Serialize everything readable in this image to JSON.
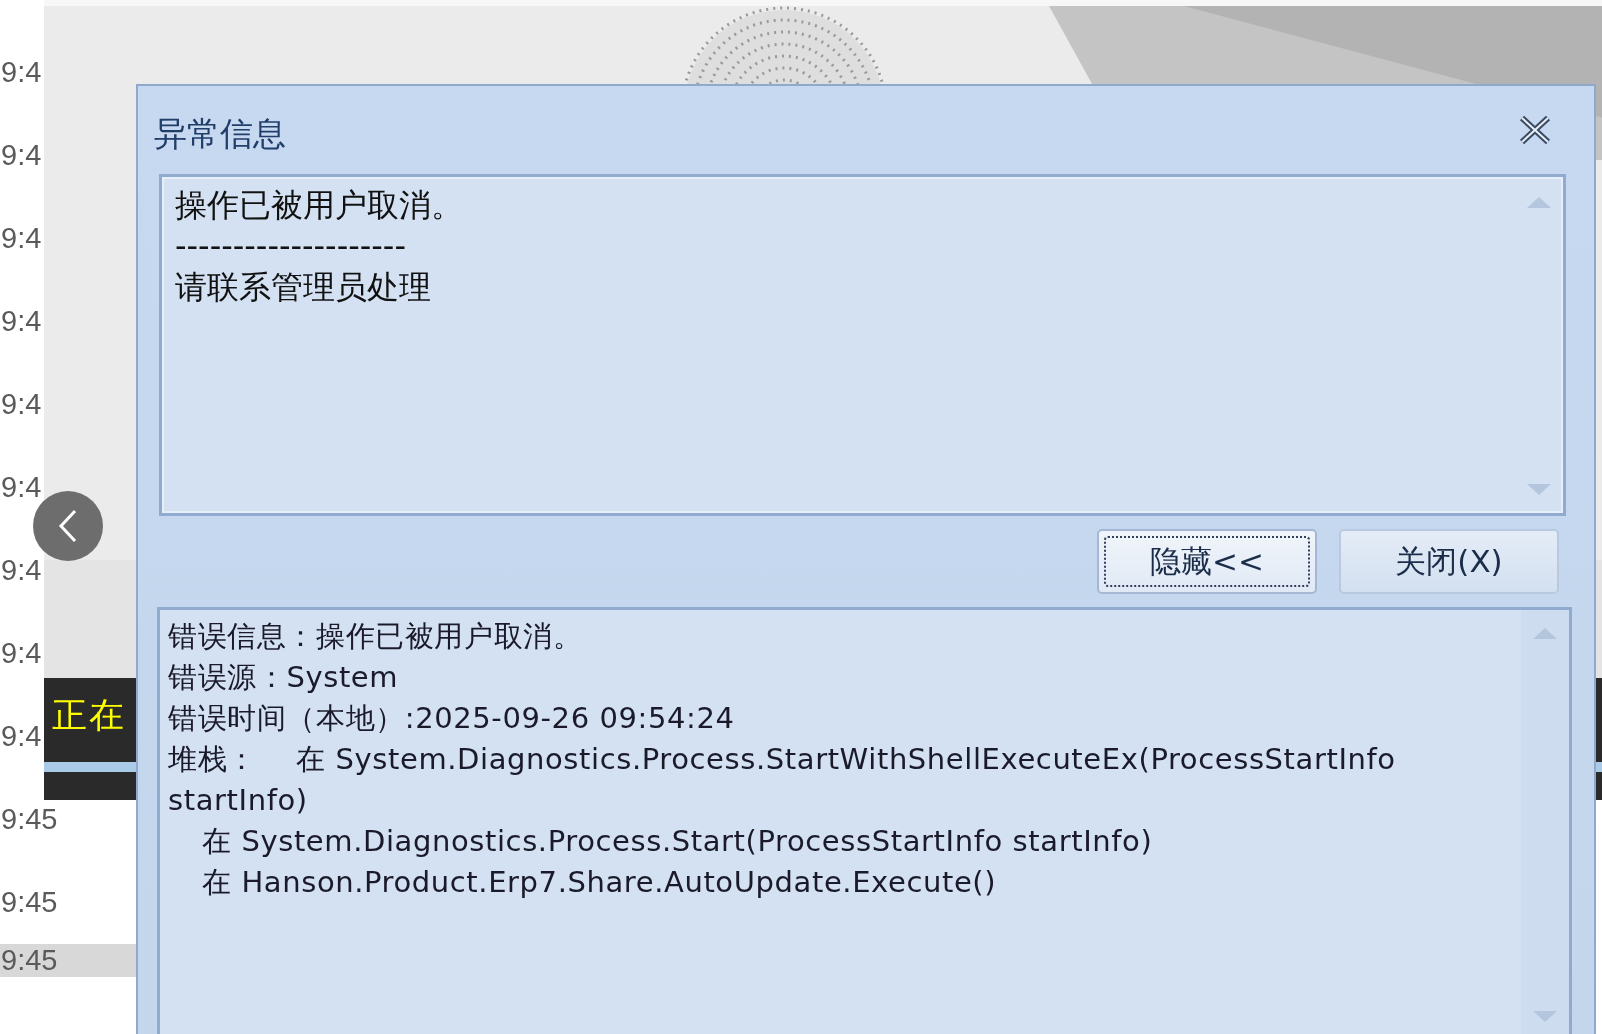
{
  "background_app": {
    "time_rows": [
      {
        "time": "9:4",
        "selected": false
      },
      {
        "time": "9:4",
        "selected": false
      },
      {
        "time": "9:4",
        "selected": false
      },
      {
        "time": "9:4",
        "selected": false
      },
      {
        "time": "9:4",
        "selected": false
      },
      {
        "time": "9:4",
        "selected": false
      },
      {
        "time": "9:4",
        "selected": false
      },
      {
        "time": "9:4",
        "selected": false
      },
      {
        "time": "9:4",
        "selected": false
      },
      {
        "time": "9:45",
        "selected": false
      },
      {
        "time": "9:45",
        "selected": false
      },
      {
        "time": "9:45",
        "selected": true
      }
    ],
    "banner": {
      "text": "正在"
    }
  },
  "dialog": {
    "title": "异常信息",
    "message_lines": [
      "操作已被用户取消。",
      "--------------------",
      "请联系管理员处理"
    ],
    "buttons": [
      {
        "label": "隐藏<<",
        "focused": true
      },
      {
        "label": "关闭(X)",
        "focused": false
      }
    ],
    "detail_lines": [
      {
        "kind": "field",
        "text": "错误信息：操作已被用户取消。"
      },
      {
        "kind": "field",
        "text": "错误源：System"
      },
      {
        "kind": "field",
        "text": "错误时间（本地）:2025-09-26 09:54:24"
      },
      {
        "kind": "field",
        "text": "堆栈：    在 System.Diagnostics.Process.StartWithShellExecuteEx(ProcessStartInfo startInfo)"
      },
      {
        "kind": "frame",
        "text": "在 System.Diagnostics.Process.Start(ProcessStartInfo startInfo)"
      },
      {
        "kind": "frame",
        "text": "在 Hanson.Product.Erp7.Share.AutoUpdate.Execute()"
      }
    ]
  }
}
